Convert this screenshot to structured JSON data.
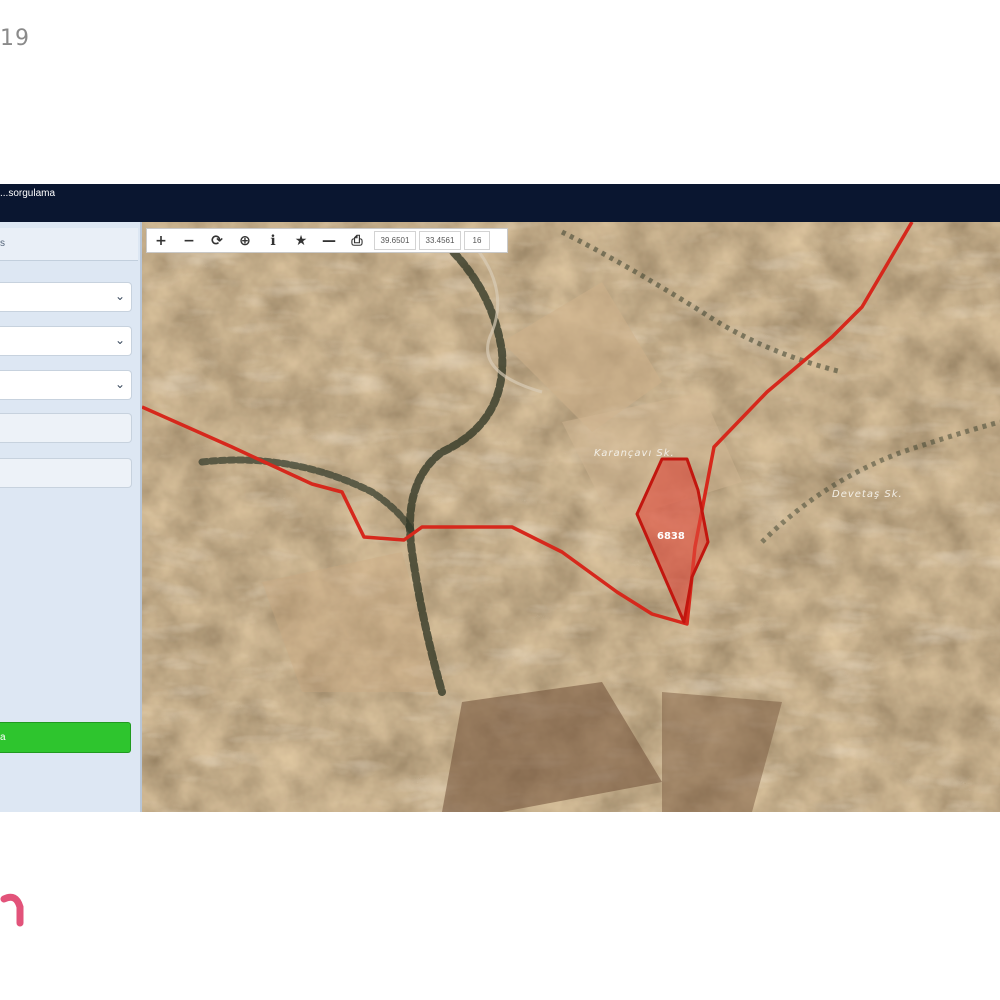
{
  "corner_label": "19",
  "app": {
    "title": "...sorgulama"
  },
  "sidebar": {
    "header_label": "s",
    "selects": [
      {
        "name": "select-1",
        "value": ""
      },
      {
        "name": "select-2",
        "value": ""
      },
      {
        "name": "select-3",
        "value": ""
      }
    ],
    "fields": [
      {
        "name": "field-1",
        "value": ""
      },
      {
        "name": "field-2",
        "value": ""
      }
    ],
    "button_label": "a",
    "button_color": "#2ec52e"
  },
  "toolbar": {
    "buttons": [
      {
        "name": "zoom-in-button",
        "icon": "plus-icon",
        "glyph": "+"
      },
      {
        "name": "zoom-out-button",
        "icon": "minus-icon",
        "glyph": "−"
      },
      {
        "name": "refresh-button",
        "icon": "refresh-icon",
        "glyph": "⟳"
      },
      {
        "name": "locate-button",
        "icon": "target-icon",
        "glyph": "⊕"
      },
      {
        "name": "info-button",
        "icon": "info-icon",
        "glyph": "ℹ"
      },
      {
        "name": "favorite-button",
        "icon": "star-icon",
        "glyph": "★"
      },
      {
        "name": "measure-button",
        "icon": "line-icon",
        "glyph": "—"
      },
      {
        "name": "print-button",
        "icon": "printer-icon",
        "glyph": "⎙"
      }
    ],
    "latitude": "39.6501",
    "longitude": "33.4561",
    "zoom_level": "16"
  },
  "map": {
    "labels": [
      {
        "name": "place-label-1",
        "text": "Karançavı Sk."
      },
      {
        "name": "place-label-2",
        "text": "Devetaş Sk."
      },
      {
        "name": "parcel-label",
        "text": "6838"
      }
    ],
    "boundary_color": "#d6281c",
    "parcel_fill": "#e0483a"
  }
}
